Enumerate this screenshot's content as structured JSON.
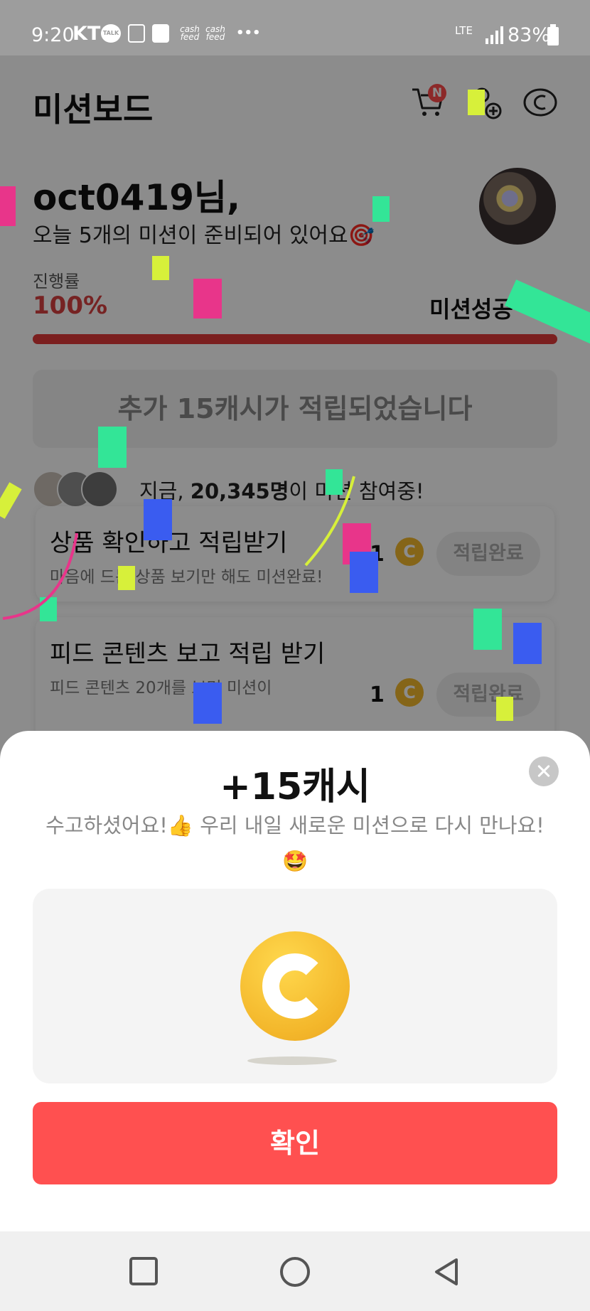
{
  "status_bar": {
    "time": "9:20",
    "carrier": "KT",
    "talk": "TALK",
    "cashfeed_1": "cash feed",
    "cashfeed_2": "cash feed",
    "more": "•••",
    "network": "LTE",
    "battery": "83%"
  },
  "header": {
    "title": "미션보드",
    "cart_badge": "N"
  },
  "greeting": {
    "name": "oct0419님,",
    "message": "오늘 5개의 미션이 준비되어 있어요",
    "message_emoji": "🎯"
  },
  "progress": {
    "label": "진행률",
    "value_text": "100%",
    "value": 1.0,
    "status": "미션성공"
  },
  "banner": {
    "text": "추가 15캐시가 적립되었습니다"
  },
  "participants": {
    "prefix": "지금, ",
    "count": "20,345명",
    "suffix": "이 미션 참여중!"
  },
  "missions": [
    {
      "title": "상품 확인하고 적립받기",
      "subtitle": "마음에 드는 상품 보기만 해도 미션완료!",
      "reward": "1",
      "button": "적립완료"
    },
    {
      "title": "피드 콘텐츠 보고 적립 받기",
      "subtitle": "피드 콘텐츠 20개를 보면 미션이",
      "reward": "1",
      "button": "적립완료"
    }
  ],
  "sheet": {
    "title": "+15캐시",
    "message": "수고하셨어요!👍 우리 내일 새로운 미션으로 다시 만나요! 🤩",
    "confirm": "확인"
  },
  "colors": {
    "accent_red": "#ff5050",
    "progress_red": "#e03a3a",
    "coin_gold": "#f3b62a"
  },
  "icons": {
    "cart": "cart-icon",
    "add_friend": "add-person-icon",
    "cash": "cash-coin-icon",
    "close": "close-icon",
    "nav_recent": "square-icon",
    "nav_home": "circle-icon",
    "nav_back": "triangle-back-icon"
  }
}
